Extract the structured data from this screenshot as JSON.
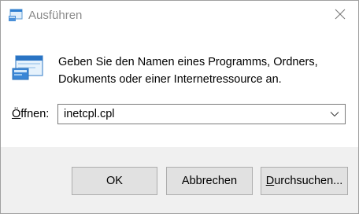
{
  "window": {
    "title": "Ausführen",
    "icon": "run-dialog-icon",
    "close_icon": "close-icon"
  },
  "content": {
    "description_line1": "Geben Sie den Namen eines Programms, Ordners,",
    "description_line2": "Dokuments oder einer Internetressource an.",
    "open_label_mnemonic": "Ö",
    "open_label_rest": "ffnen:",
    "open_value": "inetcpl.cpl",
    "dropdown_icon": "chevron-down-icon"
  },
  "buttons": {
    "ok_label": "OK",
    "cancel_label": "Abbrechen",
    "browse_mnemonic": "D",
    "browse_rest": "urchsuchen..."
  },
  "colors": {
    "footer_background": "#f0f0f0",
    "button_background": "#e1e1e1",
    "button_border": "#adadad",
    "title_text": "#8a8a8a"
  }
}
